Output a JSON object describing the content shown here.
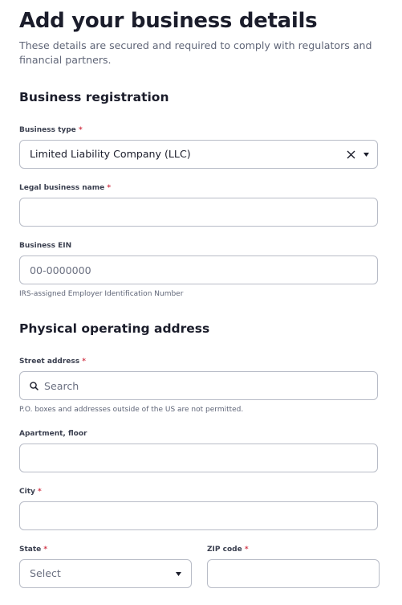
{
  "header": {
    "title": "Add your business details",
    "subtitle": "These details are secured and required to comply with regulators and financial partners."
  },
  "registration": {
    "heading": "Business registration",
    "business_type": {
      "label": "Business type",
      "required": "*",
      "value": "Limited Liability Company (LLC)"
    },
    "legal_name": {
      "label": "Legal business name",
      "required": "*",
      "value": ""
    },
    "ein": {
      "label": "Business EIN",
      "placeholder": "00-0000000",
      "hint": "IRS-assigned Employer Identification Number"
    }
  },
  "address": {
    "heading": "Physical operating address",
    "street": {
      "label": "Street address",
      "required": "*",
      "placeholder": "Search",
      "hint": "P.O. boxes and addresses outside of the US are not permitted."
    },
    "apartment": {
      "label": "Apartment, floor",
      "value": ""
    },
    "city": {
      "label": "City",
      "required": "*",
      "value": ""
    },
    "state": {
      "label": "State",
      "required": "*",
      "placeholder": "Select"
    },
    "zip": {
      "label": "ZIP code",
      "required": "*",
      "value": ""
    }
  },
  "icons": {
    "clear": "close-icon",
    "dropdown": "caret-down-icon",
    "search": "search-icon"
  }
}
